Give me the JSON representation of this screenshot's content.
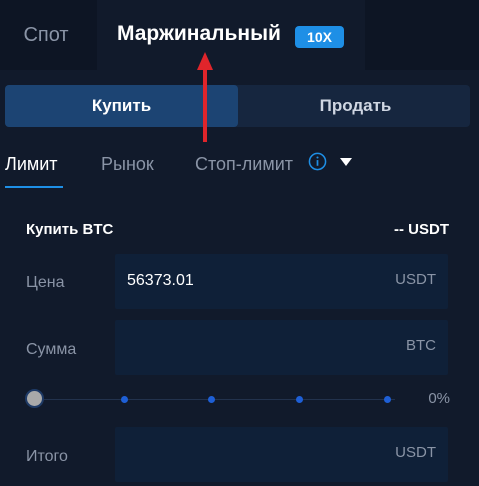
{
  "tabs": {
    "spot_label": "Спот",
    "margin_label": "Маржинальный",
    "leverage_badge": "10X"
  },
  "side": {
    "buy_label": "Купить",
    "sell_label": "Продать"
  },
  "order_types": {
    "limit_label": "Лимит",
    "market_label": "Рынок",
    "stop_limit_label": "Стоп-лимит",
    "info_icon": "info-icon",
    "dropdown_icon": "caret-down-icon"
  },
  "form": {
    "buy_title": "Купить BTC",
    "available": "-- USDT",
    "price_label": "Цена",
    "price_value": "56373.01",
    "price_unit": "USDT",
    "amount_label": "Сумма",
    "amount_value": "",
    "amount_unit": "BTC",
    "slider_percent": "0%",
    "total_label": "Итого",
    "total_value": "",
    "total_unit": "USDT"
  },
  "colors": {
    "accent": "#1e8fe6",
    "background": "#111a2b",
    "annotation_arrow": "#e0252b"
  }
}
